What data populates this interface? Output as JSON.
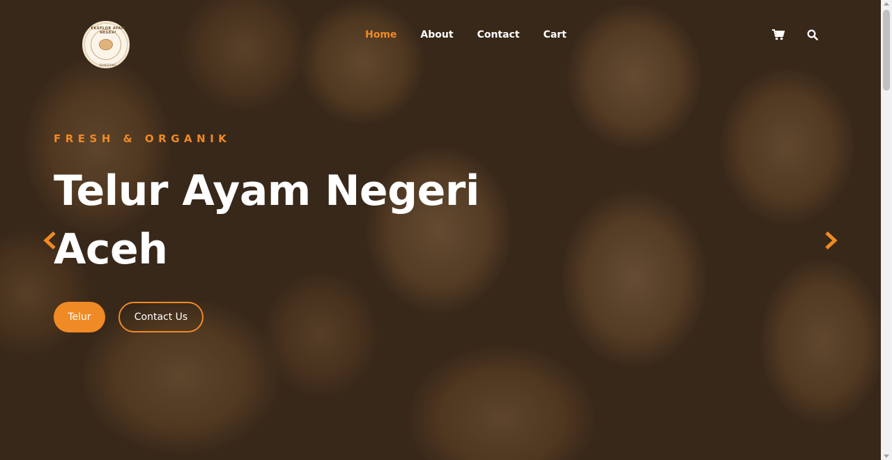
{
  "header": {
    "logo": {
      "text_top": "EKSPLOR AYAM NEGERI",
      "text_bottom": "BANDUNG"
    },
    "nav": [
      {
        "label": "Home",
        "active": true
      },
      {
        "label": "About",
        "active": false
      },
      {
        "label": "Contact",
        "active": false
      },
      {
        "label": "Cart",
        "active": false
      }
    ],
    "icons": [
      "cart-icon",
      "search-icon"
    ]
  },
  "hero": {
    "eyebrow": "FRESH & ORGANIK",
    "title": "Telur Ayam Negeri Aceh",
    "primary_button": "Telur",
    "secondary_button": "Contact Us"
  },
  "carousel": {
    "prev_icon": "chevron-left-icon",
    "next_icon": "chevron-right-icon"
  },
  "colors": {
    "accent": "#f08a24",
    "text": "#ffffff"
  }
}
